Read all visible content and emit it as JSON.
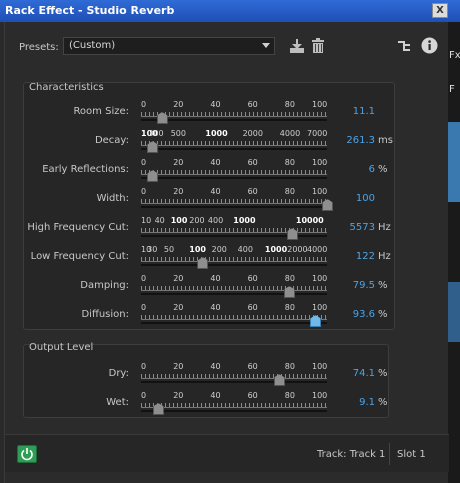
{
  "window": {
    "title": "Rack Effect - Studio Reverb",
    "close_label": "X"
  },
  "side_strip": {
    "label1": "Fx",
    "label2": "F"
  },
  "presets": {
    "label": "Presets:",
    "value": "(Custom)"
  },
  "sections": {
    "characteristics": {
      "title": "Characteristics",
      "rows": [
        {
          "label": "Room Size:",
          "value": "11.1",
          "unit": "",
          "level": 0.111,
          "ticks": [
            {
              "t": "0",
              "p": 0,
              "b": false
            },
            {
              "t": "20",
              "p": 0.2,
              "b": false
            },
            {
              "t": "40",
              "p": 0.4,
              "b": false
            },
            {
              "t": "60",
              "p": 0.6,
              "b": false
            },
            {
              "t": "80",
              "p": 0.8,
              "b": false
            },
            {
              "t": "100",
              "p": 1,
              "b": false
            }
          ]
        },
        {
          "label": "Decay:",
          "value": "261.3",
          "unit": "ms",
          "level": 0.06,
          "ticks": [
            {
              "t": "100",
              "p": 0,
              "b": true
            },
            {
              "t": "300",
              "p": 0.08,
              "b": false
            },
            {
              "t": "500",
              "p": 0.2,
              "b": false
            },
            {
              "t": "1000",
              "p": 0.4,
              "b": true
            },
            {
              "t": "2000",
              "p": 0.6,
              "b": false
            },
            {
              "t": "4000",
              "p": 0.8,
              "b": false
            },
            {
              "t": "7000",
              "p": 0.95,
              "b": false
            }
          ]
        },
        {
          "label": "Early Reflections:",
          "value": "6",
          "unit": "%",
          "level": 0.06,
          "ticks": [
            {
              "t": "0",
              "p": 0,
              "b": false
            },
            {
              "t": "20",
              "p": 0.2,
              "b": false
            },
            {
              "t": "40",
              "p": 0.4,
              "b": false
            },
            {
              "t": "60",
              "p": 0.6,
              "b": false
            },
            {
              "t": "80",
              "p": 0.8,
              "b": false
            },
            {
              "t": "100",
              "p": 1,
              "b": false
            }
          ]
        },
        {
          "label": "Width:",
          "value": "100",
          "unit": "",
          "level": 1.0,
          "ticks": [
            {
              "t": "0",
              "p": 0,
              "b": false
            },
            {
              "t": "20",
              "p": 0.2,
              "b": false
            },
            {
              "t": "40",
              "p": 0.4,
              "b": false
            },
            {
              "t": "60",
              "p": 0.6,
              "b": false
            },
            {
              "t": "80",
              "p": 0.8,
              "b": false
            },
            {
              "t": "100",
              "p": 1,
              "b": false
            }
          ]
        },
        {
          "label": "High Frequency Cut:",
          "value": "5573",
          "unit": "Hz",
          "level": 0.81,
          "ticks": [
            {
              "t": "10",
              "p": 0,
              "b": false
            },
            {
              "t": "40",
              "p": 0.1,
              "b": false
            },
            {
              "t": "100",
              "p": 0.2,
              "b": true
            },
            {
              "t": "200",
              "p": 0.3,
              "b": false
            },
            {
              "t": "400",
              "p": 0.4,
              "b": false
            },
            {
              "t": "1000",
              "p": 0.55,
              "b": true
            },
            {
              "t": "10000",
              "p": 0.9,
              "b": true
            }
          ]
        },
        {
          "label": "Low Frequency Cut:",
          "value": "122",
          "unit": "Hz",
          "level": 0.33,
          "ticks": [
            {
              "t": "10",
              "p": 0,
              "b": false
            },
            {
              "t": "30",
              "p": 0.06,
              "b": false
            },
            {
              "t": "50",
              "p": 0.15,
              "b": false
            },
            {
              "t": "100",
              "p": 0.3,
              "b": true
            },
            {
              "t": "200",
              "p": 0.42,
              "b": false
            },
            {
              "t": "400",
              "p": 0.56,
              "b": false
            },
            {
              "t": "1000",
              "p": 0.72,
              "b": true
            },
            {
              "t": "2000",
              "p": 0.84,
              "b": false
            },
            {
              "t": "4000",
              "p": 0.96,
              "b": false
            }
          ]
        },
        {
          "label": "Damping:",
          "value": "79.5",
          "unit": "%",
          "level": 0.795,
          "ticks": [
            {
              "t": "0",
              "p": 0,
              "b": false
            },
            {
              "t": "20",
              "p": 0.2,
              "b": false
            },
            {
              "t": "40",
              "p": 0.4,
              "b": false
            },
            {
              "t": "60",
              "p": 0.6,
              "b": false
            },
            {
              "t": "80",
              "p": 0.8,
              "b": false
            },
            {
              "t": "100",
              "p": 1,
              "b": false
            }
          ]
        },
        {
          "label": "Diffusion:",
          "value": "93.6",
          "unit": "%",
          "level": 0.936,
          "active": true,
          "ticks": [
            {
              "t": "0",
              "p": 0,
              "b": false
            },
            {
              "t": "20",
              "p": 0.2,
              "b": false
            },
            {
              "t": "40",
              "p": 0.4,
              "b": false
            },
            {
              "t": "60",
              "p": 0.6,
              "b": false
            },
            {
              "t": "80",
              "p": 0.8,
              "b": false
            },
            {
              "t": "100",
              "p": 1,
              "b": false
            }
          ]
        }
      ]
    },
    "output": {
      "title": "Output Level",
      "rows": [
        {
          "label": "Dry:",
          "value": "74.1",
          "unit": "%",
          "level": 0.741,
          "ticks": [
            {
              "t": "0",
              "p": 0,
              "b": false
            },
            {
              "t": "20",
              "p": 0.2,
              "b": false
            },
            {
              "t": "40",
              "p": 0.4,
              "b": false
            },
            {
              "t": "60",
              "p": 0.6,
              "b": false
            },
            {
              "t": "80",
              "p": 0.8,
              "b": false
            },
            {
              "t": "100",
              "p": 1,
              "b": false
            }
          ]
        },
        {
          "label": "Wet:",
          "value": "9.1",
          "unit": "%",
          "level": 0.091,
          "ticks": [
            {
              "t": "0",
              "p": 0,
              "b": false
            },
            {
              "t": "20",
              "p": 0.2,
              "b": false
            },
            {
              "t": "40",
              "p": 0.4,
              "b": false
            },
            {
              "t": "60",
              "p": 0.6,
              "b": false
            },
            {
              "t": "80",
              "p": 0.8,
              "b": false
            },
            {
              "t": "100",
              "p": 1,
              "b": false
            }
          ]
        }
      ]
    }
  },
  "footer": {
    "track": "Track: Track 1",
    "slot": "Slot 1"
  },
  "colors": {
    "value_blue": "#4aa3e8",
    "power_green": "#2e9e56",
    "title_blue": "#2f6bd6"
  }
}
